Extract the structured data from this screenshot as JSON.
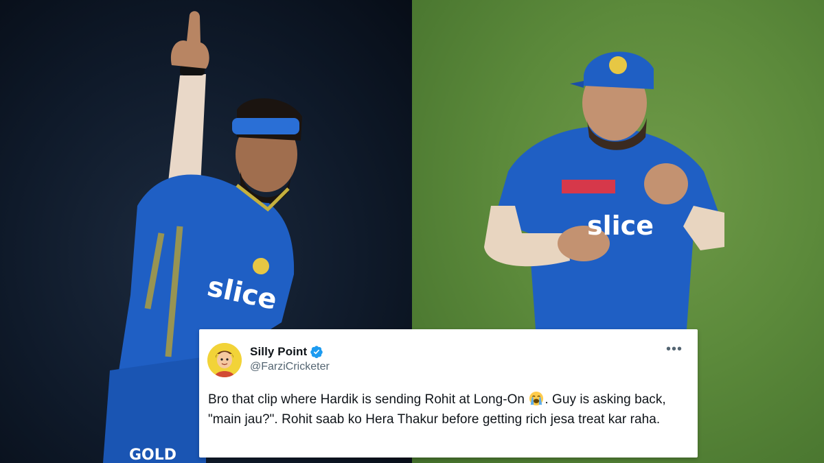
{
  "photos": {
    "left": {
      "jersey_sponsor": "slice",
      "jersey_bottom": "GOLD"
    },
    "right": {
      "jersey_sponsor": "slice"
    }
  },
  "tweet": {
    "display_name": "Silly Point",
    "handle": "@FarziCricketer",
    "verified": true,
    "more_icon": "more-icon",
    "text_part1": "Bro that clip where Hardik is sending Rohit at Long-On",
    "emoji": "loudly-crying-face",
    "text_part2": ". Guy is asking back, \"main jau?\". Rohit saab ko Hera Thakur before getting rich jesa treat kar raha."
  },
  "colors": {
    "jersey_blue": "#1f5fc4",
    "pitch_green": "#5c8a3b",
    "verified_blue": "#1d9bf0",
    "card_text": "#0f1419",
    "card_muted": "#536471"
  }
}
